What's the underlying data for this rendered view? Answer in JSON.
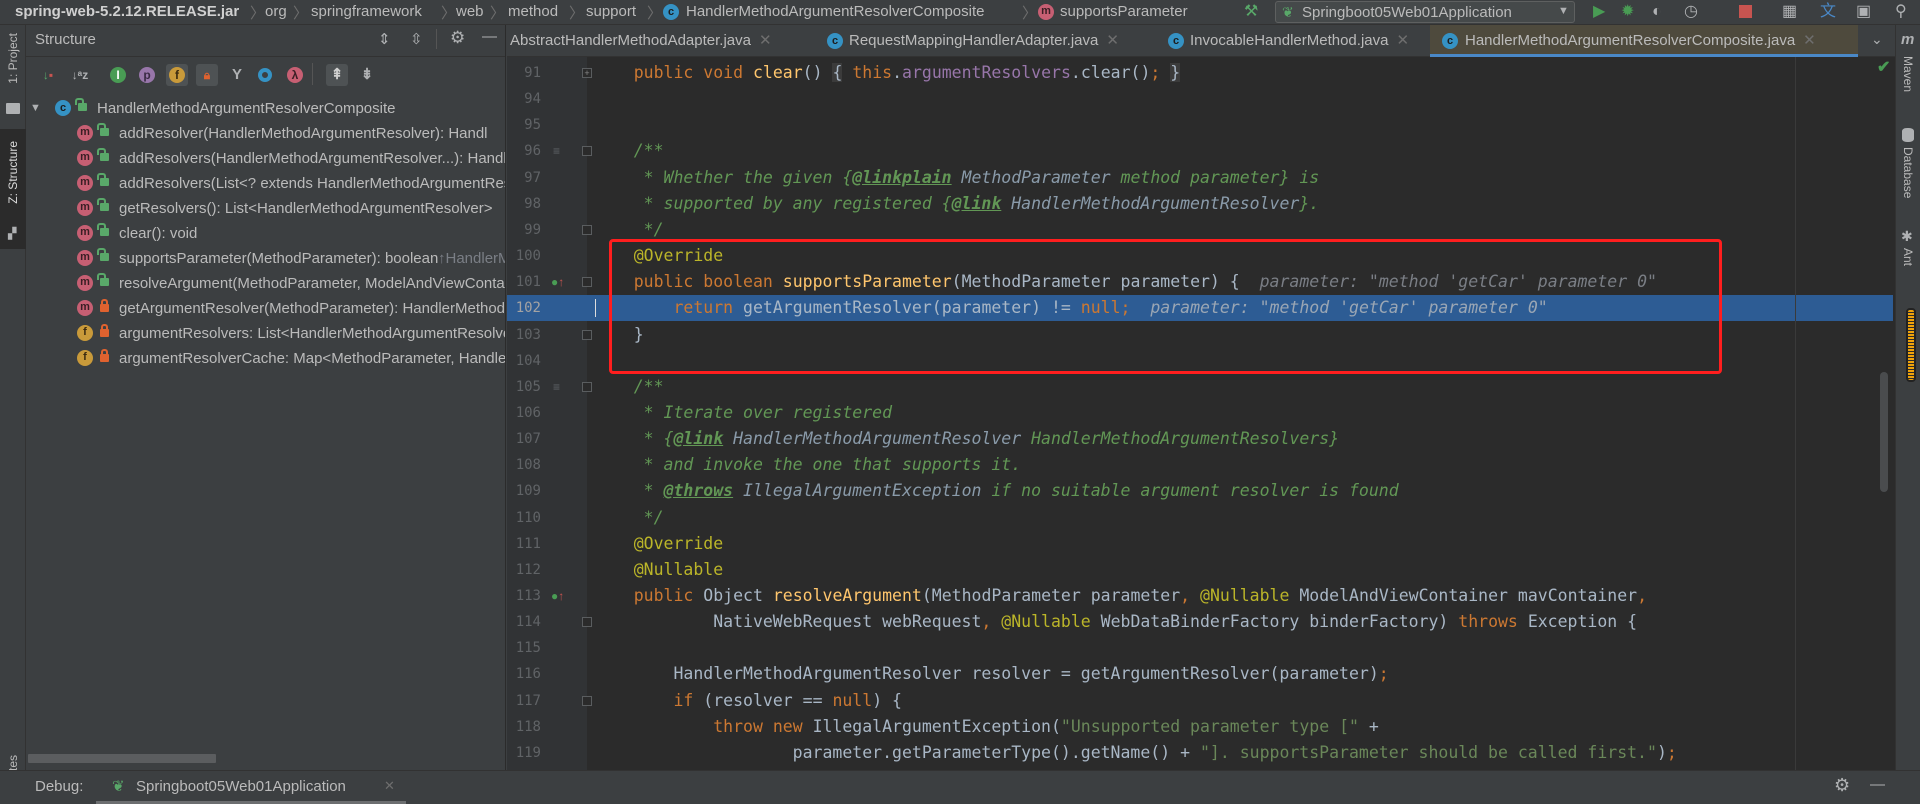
{
  "breadcrumb": {
    "items": [
      "spring-web-5.2.12.RELEASE.jar",
      "org",
      "springframework",
      "web",
      "method",
      "support",
      "HandlerMethodArgumentResolverComposite",
      "supportsParameter"
    ],
    "class_icon": "c-class-icon",
    "method_icon": "m-method-icon"
  },
  "toolbar": {
    "run_config": "Springboot05Web01Application",
    "icons": [
      "hammer-build-icon",
      "run-icon",
      "debug-icon",
      "coverage-icon",
      "profile-icon",
      "stop-icon",
      "project-structure-icon",
      "translate-icon",
      "toggle-presentation-icon",
      "search-icon"
    ]
  },
  "left_stripe": {
    "project": "1: Project",
    "structure": "Z: Structure",
    "favorites": "vorites"
  },
  "structure": {
    "title": "Structure",
    "root": "HandlerMethodArgumentResolverComposite",
    "items": [
      {
        "kind": "m",
        "visibility": "public",
        "label": "addResolver(HandlerMethodArgumentResolver): Handl",
        "suffix": ""
      },
      {
        "kind": "m",
        "visibility": "public",
        "label": "addResolvers(HandlerMethodArgumentResolver...): Handl",
        "suffix": ""
      },
      {
        "kind": "m",
        "visibility": "public",
        "label": "addResolvers(List<? extends HandlerMethodArgumentResolver>)",
        "suffix": ""
      },
      {
        "kind": "m",
        "visibility": "public",
        "label": "getResolvers(): List<HandlerMethodArgumentResolver>",
        "suffix": ""
      },
      {
        "kind": "m",
        "visibility": "public",
        "label": "clear(): void",
        "suffix": ""
      },
      {
        "kind": "m",
        "visibility": "public",
        "label": "supportsParameter(MethodParameter): boolean ",
        "suffix": "↑HandlerMethodArgumentResolver"
      },
      {
        "kind": "m",
        "visibility": "public",
        "label": "resolveArgument(MethodParameter, ModelAndViewContainer",
        "suffix": ""
      },
      {
        "kind": "m",
        "visibility": "private",
        "label": "getArgumentResolver(MethodParameter): HandlerMethodArgumentResolver",
        "suffix": ""
      },
      {
        "kind": "f",
        "visibility": "private",
        "label": "argumentResolvers: List<HandlerMethodArgumentResolver>",
        "suffix": ""
      },
      {
        "kind": "f",
        "visibility": "private",
        "label": "argumentResolverCache: Map<MethodParameter, HandlerMethodArgumentResolver>",
        "suffix": ""
      }
    ]
  },
  "tabs": [
    {
      "label": "AbstractHandlerMethodAdapter.java",
      "active": false
    },
    {
      "label": "RequestMappingHandlerAdapter.java",
      "active": false
    },
    {
      "label": "InvocableHandlerMethod.java",
      "active": false
    },
    {
      "label": "HandlerMethodArgumentResolverComposite.java",
      "active": true
    }
  ],
  "editor": {
    "highlighted_line": 102,
    "lines": [
      {
        "n": "91",
        "m": "fold-collapsed",
        "t": [
          [
            "    ",
            ""
          ],
          [
            "public void ",
            "k"
          ],
          [
            "clear",
            "f"
          ],
          [
            "() ",
            ""
          ],
          [
            "{",
            "b"
          ],
          [
            " ",
            ""
          ],
          [
            "this",
            "k"
          ],
          [
            ".",
            ""
          ],
          [
            "argumentResolvers",
            "p"
          ],
          [
            ".clear()",
            ""
          ],
          [
            ";",
            "k"
          ],
          [
            " ",
            ""
          ],
          [
            "}",
            "b"
          ]
        ]
      },
      {
        "n": "94",
        "t": []
      },
      {
        "n": "95",
        "t": []
      },
      {
        "n": "96",
        "m": "doc-fold",
        "t": [
          [
            "    /**",
            "c"
          ]
        ]
      },
      {
        "n": "97",
        "t": [
          [
            "     * Whether the given {",
            "c"
          ],
          [
            "@linkplain",
            "ct"
          ],
          [
            " MethodParameter ",
            "cr"
          ],
          [
            "method parameter} is",
            "c"
          ]
        ]
      },
      {
        "n": "98",
        "t": [
          [
            "     * supported by any registered {",
            "c"
          ],
          [
            "@link",
            "ct"
          ],
          [
            " HandlerMethodArgumentResolver",
            "cr"
          ],
          [
            "}.",
            "c"
          ]
        ]
      },
      {
        "n": "99",
        "m": "fold",
        "t": [
          [
            "     */",
            "c"
          ]
        ]
      },
      {
        "n": "100",
        "t": [
          [
            "    ",
            ""
          ],
          [
            "@Override",
            "a"
          ]
        ]
      },
      {
        "n": "101",
        "m": "override-fold",
        "t": [
          [
            "    ",
            ""
          ],
          [
            "public boolean ",
            "k"
          ],
          [
            "supportsParameter",
            "f"
          ],
          [
            "(MethodParameter parameter) {",
            ""
          ],
          [
            "  parameter: \"method 'getCar' parameter 0\"",
            "h"
          ]
        ]
      },
      {
        "n": "102",
        "t": [
          [
            "        ",
            ""
          ],
          [
            "return ",
            "k"
          ],
          [
            "getArgumentResolver(parameter) != ",
            ""
          ],
          [
            "null;",
            "k"
          ],
          [
            "  parameter: \"method 'getCar' parameter 0\"",
            "h"
          ]
        ]
      },
      {
        "n": "103",
        "m": "fold",
        "t": [
          [
            "    }",
            ""
          ]
        ]
      },
      {
        "n": "104",
        "t": []
      },
      {
        "n": "105",
        "m": "doc-fold",
        "t": [
          [
            "    /**",
            "c"
          ]
        ]
      },
      {
        "n": "106",
        "t": [
          [
            "     * Iterate over registered",
            "c"
          ]
        ]
      },
      {
        "n": "107",
        "t": [
          [
            "     * {",
            "c"
          ],
          [
            "@link",
            "ct"
          ],
          [
            " HandlerMethodArgumentResolver ",
            "cr"
          ],
          [
            "HandlerMethodArgumentResolvers}",
            "c"
          ]
        ]
      },
      {
        "n": "108",
        "t": [
          [
            "     * and invoke the one that supports it.",
            "c"
          ]
        ]
      },
      {
        "n": "109",
        "t": [
          [
            "     * ",
            "c"
          ],
          [
            "@throws",
            "ct"
          ],
          [
            " IllegalArgumentException ",
            "cr"
          ],
          [
            "if no suitable argument resolver is found",
            "c"
          ]
        ]
      },
      {
        "n": "110",
        "t": [
          [
            "     */",
            "c"
          ]
        ]
      },
      {
        "n": "111",
        "t": [
          [
            "    ",
            ""
          ],
          [
            "@Override",
            "a"
          ]
        ]
      },
      {
        "n": "112",
        "t": [
          [
            "    ",
            ""
          ],
          [
            "@Nullable",
            "a"
          ]
        ]
      },
      {
        "n": "113",
        "m": "override",
        "t": [
          [
            "    ",
            ""
          ],
          [
            "public ",
            "k"
          ],
          [
            "Object ",
            ""
          ],
          [
            "resolveArgument",
            "f"
          ],
          [
            "(MethodParameter parameter",
            ""
          ],
          [
            ", ",
            "k"
          ],
          [
            "@Nullable ",
            "a"
          ],
          [
            "ModelAndViewContainer mavContainer",
            ""
          ],
          [
            ",",
            "k"
          ]
        ]
      },
      {
        "n": "114",
        "m": "fold",
        "t": [
          [
            "            NativeWebRequest webRequest",
            ""
          ],
          [
            ", ",
            "k"
          ],
          [
            "@Nullable ",
            "a"
          ],
          [
            "WebDataBinderFactory binderFactory) ",
            ""
          ],
          [
            "throws ",
            "k"
          ],
          [
            "Exception {",
            ""
          ]
        ]
      },
      {
        "n": "115",
        "t": []
      },
      {
        "n": "116",
        "t": [
          [
            "        HandlerMethodArgumentResolver resolver = getArgumentResolver(parameter)",
            ""
          ],
          [
            ";",
            "k"
          ]
        ]
      },
      {
        "n": "117",
        "m": "fold",
        "t": [
          [
            "        ",
            ""
          ],
          [
            "if ",
            "k"
          ],
          [
            "(resolver == ",
            ""
          ],
          [
            "null",
            "k"
          ],
          [
            ") {",
            ""
          ]
        ]
      },
      {
        "n": "118",
        "t": [
          [
            "            ",
            ""
          ],
          [
            "throw new ",
            "k"
          ],
          [
            "IllegalArgumentException(",
            ""
          ],
          [
            "\"Unsupported parameter type [\"",
            "s"
          ],
          [
            " +",
            ""
          ]
        ]
      },
      {
        "n": "119",
        "t": [
          [
            "                    parameter.getParameterType().getName() + ",
            ""
          ],
          [
            "\"]. supportsParameter should be called first.\"",
            "s"
          ],
          [
            ")",
            ""
          ],
          [
            ";",
            "k"
          ]
        ]
      }
    ]
  },
  "right_stripe": {
    "maven": "Maven",
    "database": "Database",
    "ant": "Ant"
  },
  "debug": {
    "label": "Debug:",
    "config": "Springboot05Web01Application"
  },
  "colors": {
    "highlight": "#2D5C94",
    "annotation_box": "#FF1E1E",
    "active_tab_underline": "#4A88C7"
  }
}
